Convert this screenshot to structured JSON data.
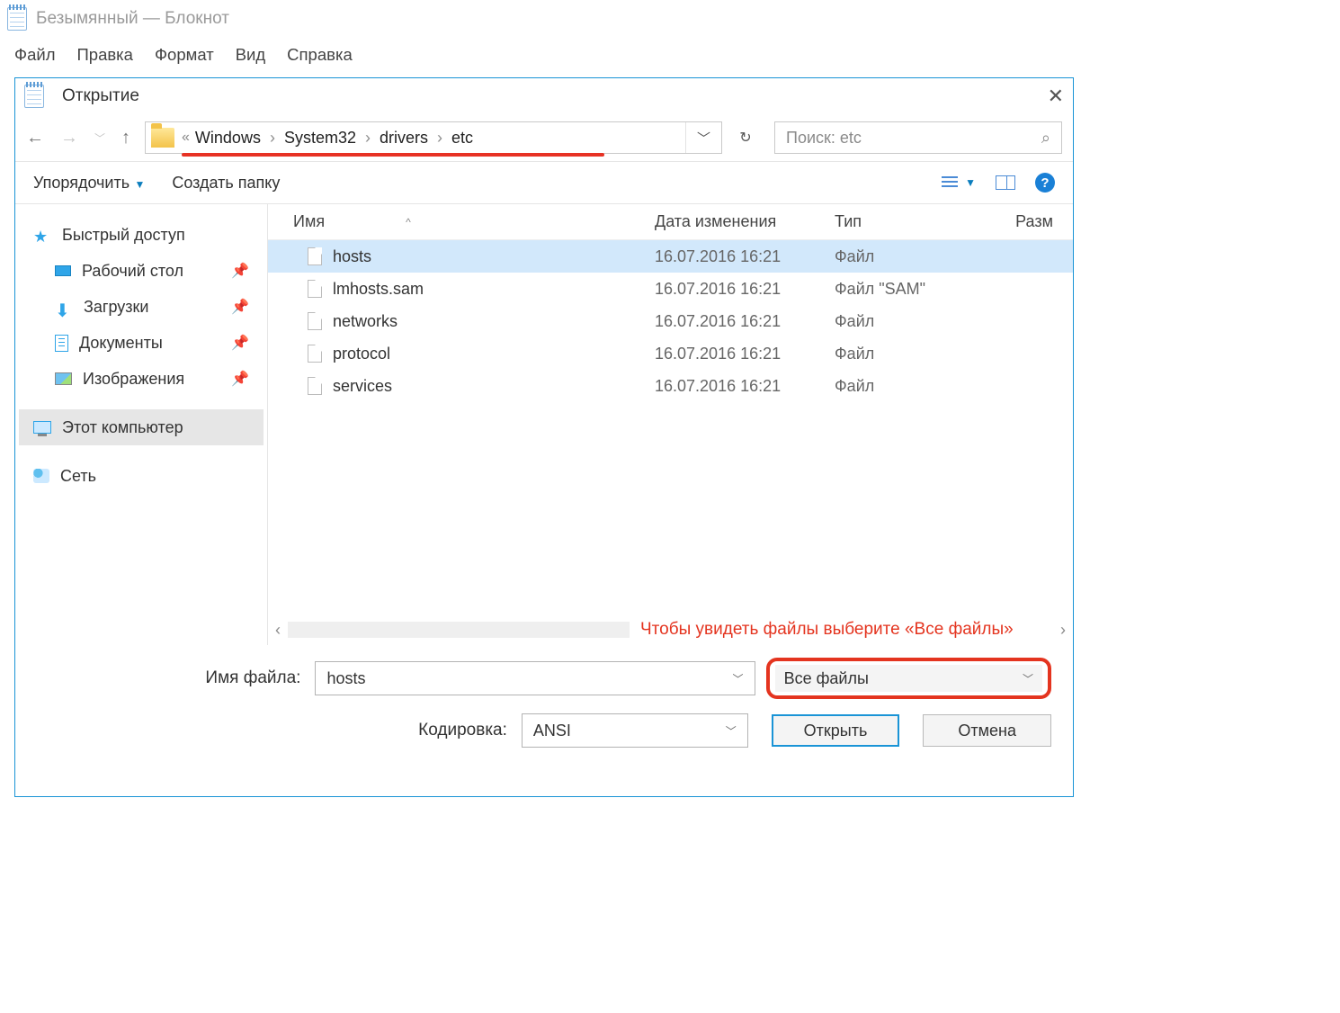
{
  "notepad": {
    "title": "Безымянный — Блокнот",
    "menu": [
      "Файл",
      "Правка",
      "Формат",
      "Вид",
      "Справка"
    ]
  },
  "dialog": {
    "title": "Открытие",
    "breadcrumb": {
      "prefix": "«",
      "items": [
        "Windows",
        "System32",
        "drivers",
        "etc"
      ]
    },
    "search_placeholder": "Поиск: etc",
    "toolbar": {
      "organize": "Упорядочить",
      "newfolder": "Создать папку"
    },
    "sidebar": {
      "quick": "Быстрый доступ",
      "desktop": "Рабочий стол",
      "downloads": "Загрузки",
      "documents": "Документы",
      "pictures": "Изображения",
      "thispc": "Этот компьютер",
      "network": "Сеть"
    },
    "columns": {
      "name": "Имя",
      "date": "Дата изменения",
      "type": "Тип",
      "size": "Разм"
    },
    "files": [
      {
        "name": "hosts",
        "date": "16.07.2016 16:21",
        "type": "Файл",
        "selected": true
      },
      {
        "name": "lmhosts.sam",
        "date": "16.07.2016 16:21",
        "type": "Файл \"SAM\"",
        "selected": false
      },
      {
        "name": "networks",
        "date": "16.07.2016 16:21",
        "type": "Файл",
        "selected": false
      },
      {
        "name": "protocol",
        "date": "16.07.2016 16:21",
        "type": "Файл",
        "selected": false
      },
      {
        "name": "services",
        "date": "16.07.2016 16:21",
        "type": "Файл",
        "selected": false
      }
    ],
    "annotation": "Чтобы увидеть файлы выберите «Все файлы»",
    "filename_label": "Имя файла:",
    "filename_value": "hosts",
    "filetype_value": "Все файлы",
    "encoding_label": "Кодировка:",
    "encoding_value": "ANSI",
    "open_btn": "Открыть",
    "cancel_btn": "Отмена"
  }
}
